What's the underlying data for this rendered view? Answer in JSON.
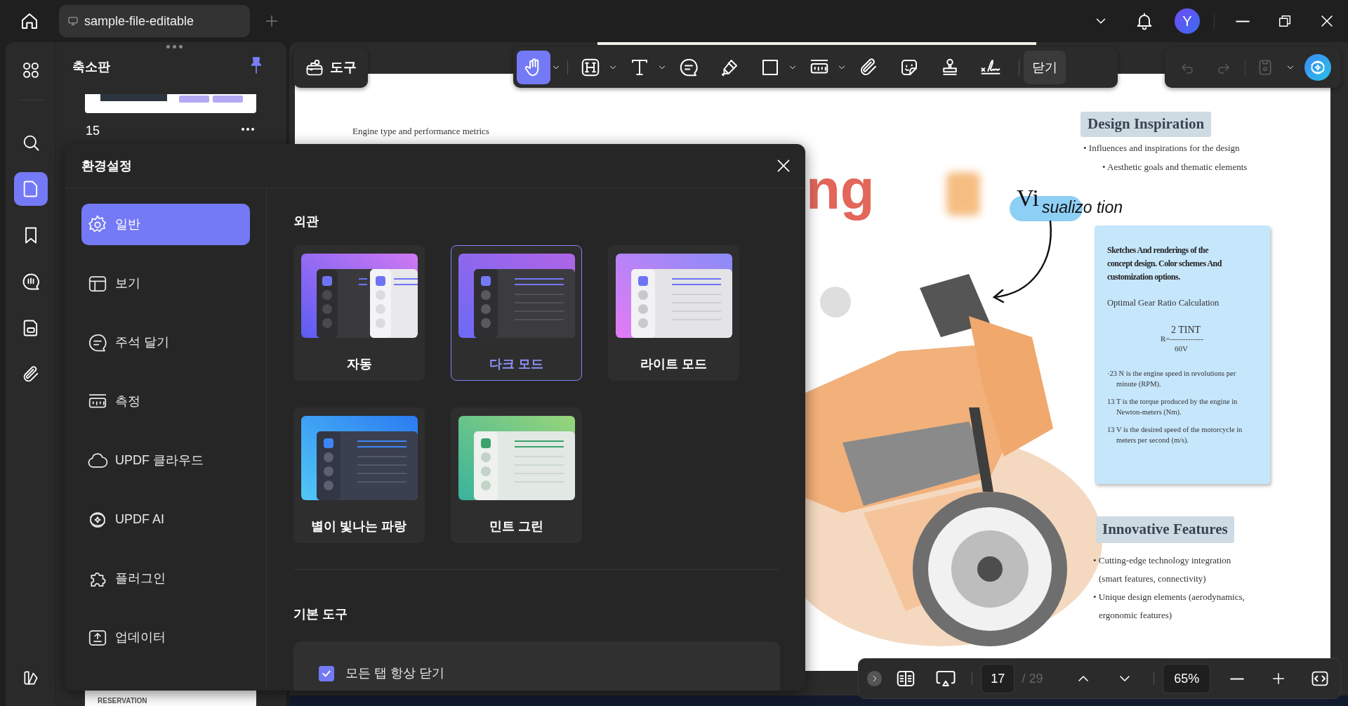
{
  "title_bar": {
    "tab": "sample-file-editable",
    "avatar": "Y"
  },
  "left_rail": [
    {
      "selected": false
    },
    {
      "selected": false
    },
    {
      "selected": true
    },
    {
      "selected": false
    },
    {
      "selected": false
    },
    {
      "selected": false
    },
    {
      "selected": false
    },
    {
      "selected": false
    }
  ],
  "thumbnails": {
    "title": "축소판",
    "page_number": "15",
    "next_thumbnail_text": "RESERVATION"
  },
  "toolbar": {
    "tools_button": "도구",
    "tools": [
      {
        "selected": true
      },
      {
        "selected": false
      },
      {
        "selected": false
      },
      {
        "selected": false
      },
      {
        "selected": false
      },
      {
        "selected": false
      },
      {
        "selected": false
      },
      {
        "selected": false
      },
      {
        "selected": false
      },
      {
        "selected": false
      },
      {
        "selected": false
      }
    ],
    "close_button": "닫기"
  },
  "document": {
    "caption": "Engine type and performance metrics",
    "title_fragment": "ng",
    "handwriting_large": "Vi",
    "handwriting": "sualizo tion",
    "design_heading": "Design Inspiration",
    "design_bullets": [
      "• Influences and inspirations for the design",
      "• Aesthetic goals and thematic elements"
    ],
    "note": {
      "sketch_text": "Sketches And renderings of the concept design. Color schemes And customization options.",
      "formula_title": "Optimal Gear Ratio Calculation",
      "numerator": "2 TINT",
      "equation": "R=-------------",
      "denominator": "60V",
      "definitions": [
        "·23 N is the engine speed in revolutions per minute (RPM).",
        "13 T is the torque produced by the engine in Newton-meters (Nm).",
        "13 V is the desired speed of the motorcycle in meters per second (m/s)."
      ]
    },
    "features_heading": "Innovative Features",
    "features_bullets": [
      "• Cutting-edge technology integration",
      "(smart features, connectivity)",
      "• Unique design elements (aerodynamics,",
      "ergonomic features)"
    ]
  },
  "preferences": {
    "title": "환경설정",
    "nav": [
      {
        "label": "일반",
        "selected": true
      },
      {
        "label": "보기",
        "selected": false
      },
      {
        "label": "주석 달기",
        "selected": false
      },
      {
        "label": "측정",
        "selected": false
      },
      {
        "label": "UPDF 클라우드",
        "selected": false
      },
      {
        "label": "UPDF AI",
        "selected": false
      },
      {
        "label": "플러그인",
        "selected": false
      },
      {
        "label": "업데이터",
        "selected": false
      }
    ],
    "appearance": {
      "heading": "외관",
      "themes": [
        {
          "label": "자동",
          "kind": "auto",
          "selected": false
        },
        {
          "label": "다크 모드",
          "kind": "dark",
          "selected": true
        },
        {
          "label": "라이트 모드",
          "kind": "light",
          "selected": false
        },
        {
          "label": "별이 빛나는 파랑",
          "kind": "blue",
          "selected": false
        },
        {
          "label": "민트 그린",
          "kind": "mint",
          "selected": false
        }
      ]
    },
    "basic_tools": {
      "heading": "기본 도구",
      "options": [
        {
          "label": "모든 탭 항상 닫기",
          "checked": true
        }
      ]
    }
  },
  "page_nav": {
    "page": "17",
    "total": "/ 29",
    "zoom": "65%"
  }
}
